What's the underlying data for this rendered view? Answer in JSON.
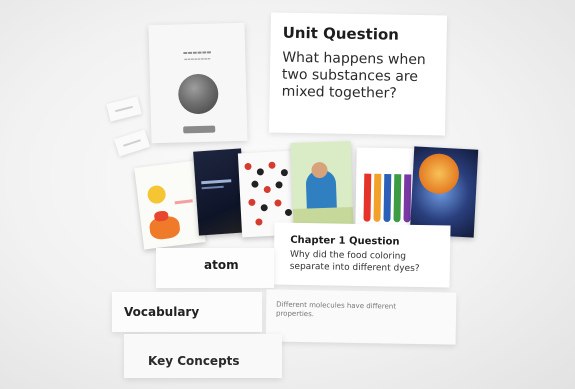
{
  "unit_card": {
    "title": "Unit Question",
    "question": "What happens when two substances are mixed together?"
  },
  "chapter_card": {
    "title": "Chapter 1 Question",
    "question": "Why did the food coloring separate into different dyes?"
  },
  "vocab_word": "atom",
  "vocab_label": "Vocabulary",
  "concept_text": "Different molecules have different properties.",
  "key_concepts_label": "Key Concepts",
  "colors": {
    "background": "#f2f2f2",
    "card": "#ffffff",
    "text": "#1d1d1d"
  }
}
